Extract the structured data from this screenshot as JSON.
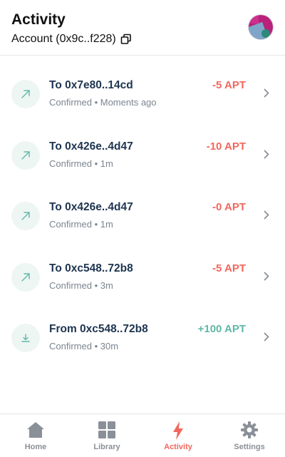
{
  "header": {
    "title": "Activity",
    "account_label": "Account (0x9c..f228)"
  },
  "transactions": [
    {
      "title": "To 0x7e80..14cd",
      "status": "Confirmed",
      "time": "Moments ago",
      "amount": "-5 APT",
      "direction": "sent",
      "icon": "arrow-up-right-icon"
    },
    {
      "title": "To 0x426e..4d47",
      "status": "Confirmed",
      "time": "1m",
      "amount": "-10 APT",
      "direction": "sent",
      "icon": "arrow-up-right-icon"
    },
    {
      "title": "To 0x426e..4d47",
      "status": "Confirmed",
      "time": "1m",
      "amount": "-0 APT",
      "direction": "sent",
      "icon": "arrow-up-right-icon"
    },
    {
      "title": "To 0xc548..72b8",
      "status": "Confirmed",
      "time": "3m",
      "amount": "-5 APT",
      "direction": "sent",
      "icon": "arrow-up-right-icon"
    },
    {
      "title": "From 0xc548..72b8",
      "status": "Confirmed",
      "time": "30m",
      "amount": "+100 APT",
      "direction": "received",
      "icon": "download-icon"
    }
  ],
  "tabs": [
    {
      "label": "Home",
      "icon": "home-icon",
      "active": false
    },
    {
      "label": "Library",
      "icon": "grid-icon",
      "active": false
    },
    {
      "label": "Activity",
      "icon": "lightning-icon",
      "active": true
    },
    {
      "label": "Settings",
      "icon": "gear-icon",
      "active": false
    }
  ],
  "colors": {
    "negative": "#f2675d",
    "positive": "#60b8a8",
    "icon_bg": "#eef6f4",
    "active_tab": "#f2675d",
    "inactive_tab": "#8a9098"
  }
}
